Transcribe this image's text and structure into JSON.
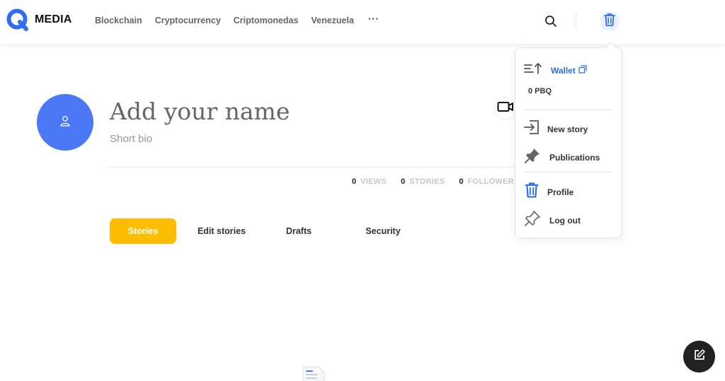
{
  "brand": {
    "name": "MEDIA",
    "accent": "#2f6df5"
  },
  "nav": {
    "items": [
      "Blockchain",
      "Cryptocurrency",
      "Criptomonedas",
      "Venezuela"
    ],
    "more_label": "···"
  },
  "profile": {
    "name_placeholder": "Add your name",
    "bio_placeholder": "Short bio",
    "stats": [
      {
        "value": "0",
        "label": "VIEWS"
      },
      {
        "value": "0",
        "label": "STORIES"
      },
      {
        "value": "0",
        "label": "FOLLOWERS"
      }
    ]
  },
  "tabs": [
    {
      "label": "Stories",
      "active": true
    },
    {
      "label": "Edit stories",
      "active": false
    },
    {
      "label": "Drafts",
      "active": false
    },
    {
      "label": "Security",
      "active": false
    }
  ],
  "menu": {
    "wallet_label": "Wallet",
    "balance": "0 PBQ",
    "new_story": "New story",
    "publications": "Publications",
    "profile": "Profile",
    "logout": "Log out"
  },
  "colors": {
    "tab_active_bg": "#fdbd02",
    "avatar_bg": "#4a78f5",
    "fab_bg": "#222222"
  },
  "icons": [
    "search-icon",
    "trash-icon",
    "user-icon",
    "video-camera-icon",
    "wallet-sort-icon",
    "external-link-icon",
    "new-story-icon",
    "pin-icon",
    "logout-pin-icon",
    "edit-icon",
    "document-icon",
    "more-icon"
  ]
}
